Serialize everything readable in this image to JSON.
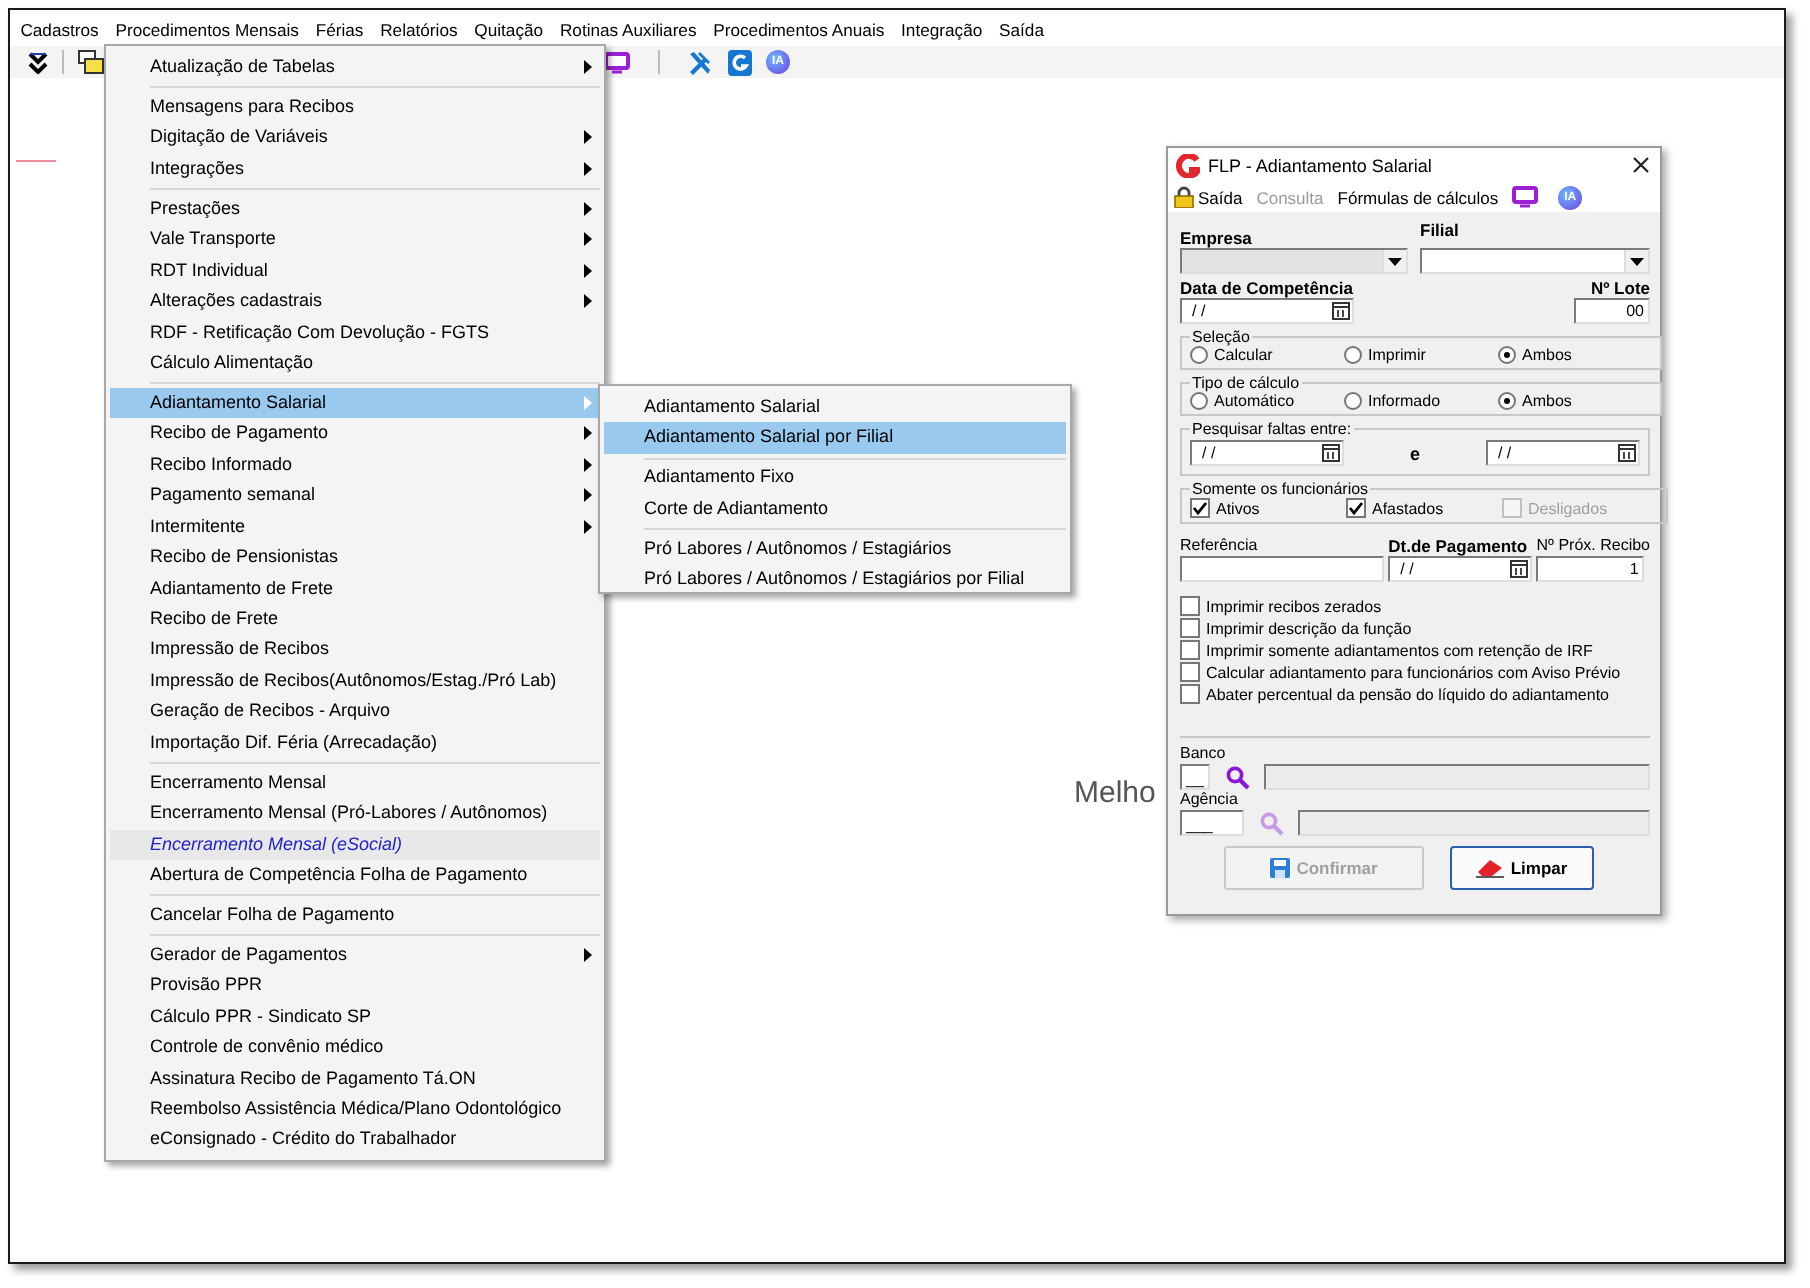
{
  "menubar": [
    {
      "label": "Cadastros"
    },
    {
      "label": "Procedimentos Mensais"
    },
    {
      "label": "Férias"
    },
    {
      "label": "Relatórios"
    },
    {
      "label": "Quitação"
    },
    {
      "label": "Rotinas Auxiliares"
    },
    {
      "label": "Procedimentos Anuais"
    },
    {
      "label": "Integração"
    },
    {
      "label": "Saída"
    }
  ],
  "toolbar": {
    "ai_badge": "IA"
  },
  "menu": {
    "items": [
      {
        "kind": "item",
        "label": "Atualização de Tabelas",
        "submenu": true,
        "selected": false
      },
      {
        "kind": "separator"
      },
      {
        "kind": "item",
        "label": "Mensagens para Recibos",
        "submenu": false,
        "selected": false
      },
      {
        "kind": "item",
        "label": "Digitação de Variáveis",
        "submenu": true,
        "selected": false
      },
      {
        "kind": "item",
        "label": "Integrações",
        "submenu": true,
        "selected": false
      },
      {
        "kind": "separator"
      },
      {
        "kind": "item",
        "label": "Prestações",
        "submenu": true,
        "selected": false
      },
      {
        "kind": "item",
        "label": "Vale Transporte",
        "submenu": true,
        "selected": false
      },
      {
        "kind": "item",
        "label": "RDT Individual",
        "submenu": true,
        "selected": false
      },
      {
        "kind": "item",
        "label": "Alterações cadastrais",
        "submenu": true,
        "selected": false
      },
      {
        "kind": "item",
        "label": "RDF - Retificação Com Devolução - FGTS",
        "submenu": false,
        "selected": false
      },
      {
        "kind": "item",
        "label": "Cálculo Alimentação",
        "submenu": false,
        "selected": false
      },
      {
        "kind": "separator"
      },
      {
        "kind": "item",
        "label": "Adiantamento Salarial",
        "submenu": true,
        "selected": true
      },
      {
        "kind": "item",
        "label": "Recibo de Pagamento",
        "submenu": true,
        "selected": false
      },
      {
        "kind": "item",
        "label": "Recibo Informado",
        "submenu": true,
        "selected": false
      },
      {
        "kind": "item",
        "label": "Pagamento semanal",
        "submenu": true,
        "selected": false
      },
      {
        "kind": "item",
        "label": "Intermitente",
        "submenu": true,
        "selected": false
      },
      {
        "kind": "item",
        "label": "Recibo de Pensionistas",
        "submenu": false,
        "selected": false
      },
      {
        "kind": "item",
        "label": "Adiantamento de Frete",
        "submenu": false,
        "selected": false
      },
      {
        "kind": "item",
        "label": "Recibo de Frete",
        "submenu": false,
        "selected": false
      },
      {
        "kind": "item",
        "label": "Impressão de Recibos",
        "submenu": false,
        "selected": false
      },
      {
        "kind": "item",
        "label": "Impressão de Recibos(Autônomos/Estag./Pró Lab)",
        "submenu": false,
        "selected": false
      },
      {
        "kind": "item",
        "label": "Geração de Recibos - Arquivo",
        "submenu": false,
        "selected": false
      },
      {
        "kind": "item",
        "label": "Importação Dif. Féria (Arrecadação)",
        "submenu": false,
        "selected": false
      },
      {
        "kind": "separator"
      },
      {
        "kind": "item",
        "label": "Encerramento Mensal",
        "submenu": false,
        "selected": false
      },
      {
        "kind": "item",
        "label": "Encerramento Mensal (Pró-Labores / Autônomos)",
        "submenu": false,
        "selected": false
      },
      {
        "kind": "emphasized",
        "label": "Encerramento Mensal (eSocial)",
        "submenu": false,
        "selected": false
      },
      {
        "kind": "item",
        "label": "Abertura de Competência Folha de Pagamento",
        "submenu": false,
        "selected": false
      },
      {
        "kind": "separator"
      },
      {
        "kind": "item",
        "label": "Cancelar Folha de Pagamento",
        "submenu": false,
        "selected": false
      },
      {
        "kind": "separator"
      },
      {
        "kind": "item",
        "label": "Gerador de Pagamentos",
        "submenu": true,
        "selected": false
      },
      {
        "kind": "item",
        "label": "Provisão PPR",
        "submenu": false,
        "selected": false
      },
      {
        "kind": "item",
        "label": "Cálculo PPR - Sindicato SP",
        "submenu": false,
        "selected": false
      },
      {
        "kind": "item",
        "label": "Controle de convênio médico",
        "submenu": false,
        "selected": false
      },
      {
        "kind": "item",
        "label": "Assinatura Recibo de Pagamento Tá.ON",
        "submenu": false,
        "selected": false
      },
      {
        "kind": "item",
        "label": "Reembolso Assistência Médica/Plano Odontológico",
        "submenu": false,
        "selected": false
      },
      {
        "kind": "item",
        "label": "eConsignado - Crédito do Trabalhador",
        "submenu": false,
        "selected": false
      }
    ]
  },
  "submenu": {
    "items": [
      {
        "kind": "item",
        "label": "Adiantamento Salarial",
        "submenu": false,
        "selected": false
      },
      {
        "kind": "item",
        "label": "Adiantamento Salarial por Filial",
        "submenu": false,
        "selected": true
      },
      {
        "kind": "separator"
      },
      {
        "kind": "item",
        "label": "Adiantamento Fixo",
        "submenu": false,
        "selected": false
      },
      {
        "kind": "item",
        "label": "Corte de Adiantamento",
        "submenu": false,
        "selected": false
      },
      {
        "kind": "separator"
      },
      {
        "kind": "item",
        "label": "Pró Labores / Autônomos / Estagiários",
        "submenu": false,
        "selected": false
      },
      {
        "kind": "item",
        "label": "Pró Labores / Autônomos / Estagiários por Filial",
        "submenu": false,
        "selected": false
      }
    ]
  },
  "background_text": "Melho",
  "dialog": {
    "title": "FLP - Adiantamento Salarial",
    "toolbar": [
      {
        "kind": "lock",
        "label": "Saída",
        "disabled": false
      },
      {
        "kind": "text",
        "label": "Consulta",
        "disabled": true
      },
      {
        "kind": "text",
        "label": "Fórmulas de cálculos",
        "disabled": false
      },
      {
        "kind": "monitor"
      },
      {
        "kind": "ai",
        "label": "IA"
      }
    ],
    "empresa": {
      "label": "Empresa",
      "disabled": true
    },
    "filial": {
      "label": "Filial",
      "disabled": false
    },
    "competencia": {
      "label": "Data de Competência",
      "value": "/ /"
    },
    "lote": {
      "label": "Nº Lote",
      "value": "00"
    },
    "selecao": {
      "legend": "Seleção",
      "options": [
        {
          "label": "Calcular",
          "selected": false
        },
        {
          "label": "Imprimir",
          "selected": false
        },
        {
          "label": "Ambos",
          "selected": true
        }
      ]
    },
    "tipo_calculo": {
      "legend": "Tipo de cálculo",
      "options": [
        {
          "label": "Automático",
          "selected": false
        },
        {
          "label": "Informado",
          "selected": false
        },
        {
          "label": "Ambos",
          "selected": true
        }
      ]
    },
    "faltas": {
      "legend": "Pesquisar faltas entre:",
      "from": "/ /",
      "joiner": "e",
      "to": "/ /"
    },
    "funcionarios": {
      "legend": "Somente os funcionários",
      "options": [
        {
          "label": "Ativos",
          "checked": true,
          "disabled": false
        },
        {
          "label": "Afastados",
          "checked": true,
          "disabled": false
        },
        {
          "label": "Desligados",
          "checked": false,
          "disabled": true
        }
      ]
    },
    "referencia": {
      "label": "Referência"
    },
    "pagamento": {
      "label": "Dt.de Pagamento",
      "value": "/ /"
    },
    "recibo": {
      "label": "Nº Próx. Recibo",
      "value": "1"
    },
    "options": [
      {
        "label": "Imprimir recibos zerados",
        "checked": false
      },
      {
        "label": "Imprimir descrição da função",
        "checked": false
      },
      {
        "label": "Imprimir somente adiantamentos com retenção de IRF",
        "checked": false
      },
      {
        "label": "Calcular adiantamento para funcionários com Aviso Prévio",
        "checked": false
      },
      {
        "label": "Abater percentual da pensão do líquido do adiantamento",
        "checked": false
      }
    ],
    "banco": {
      "label": "Banco",
      "value": "__",
      "lookup_disabled": false
    },
    "agencia": {
      "label": "Agência",
      "value": "___",
      "lookup_disabled": true
    },
    "buttons": [
      {
        "kind": "save",
        "label": "Confirmar",
        "disabled": true
      },
      {
        "kind": "eraser",
        "label": "Limpar",
        "disabled": false
      }
    ]
  }
}
